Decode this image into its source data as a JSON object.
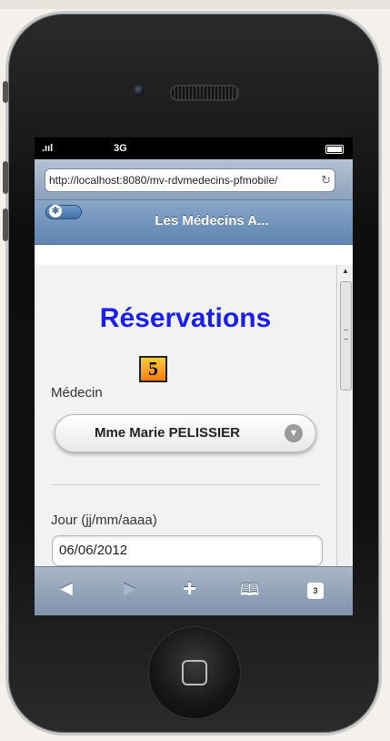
{
  "status_bar": {
    "signal": ".ııl",
    "carrier": "3G"
  },
  "browser": {
    "url": "http://localhost:8080/mv-rdvmedecins-pfmobile/",
    "reload_icon": "reload-icon"
  },
  "header": {
    "title": "Les Médecins A..."
  },
  "page": {
    "title": "Réservations",
    "badge": "5",
    "medecin_label": "Médecin",
    "medecin_selected": "Mme Marie PELISSIER",
    "jour_label": "Jour (jj/mm/aaaa)",
    "jour_value": "06/06/2012"
  },
  "toolbar": {
    "back": "◀",
    "forward": "▶",
    "add": "+",
    "bookmarks": "🕮",
    "tabs": "3"
  },
  "colors": {
    "title": "#1a1ef0",
    "header": "#6f91bb",
    "badge": "#ff9a20"
  }
}
